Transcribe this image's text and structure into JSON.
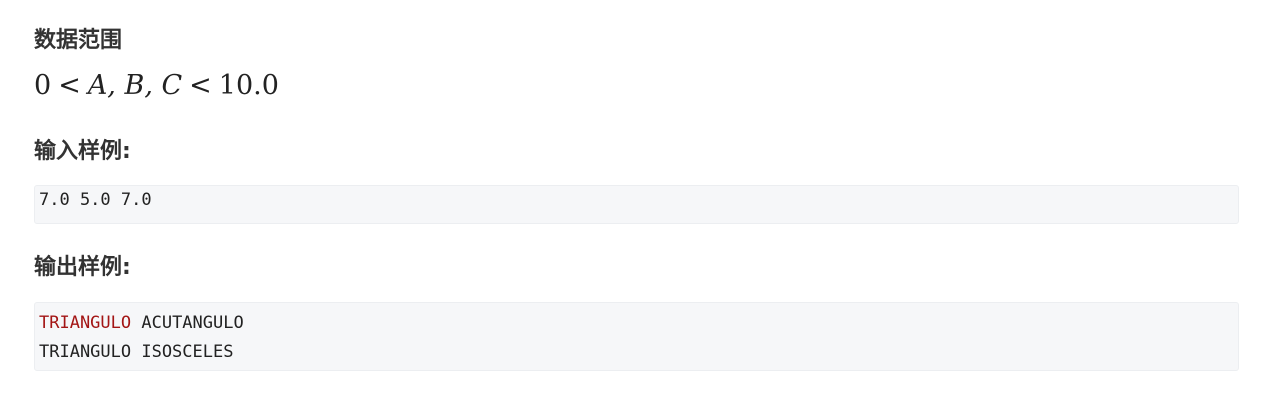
{
  "sections": {
    "range_heading": "数据范围",
    "input_heading": "输入样例:",
    "output_heading": "输出样例:"
  },
  "range": {
    "zero": "0",
    "lt": "<",
    "vars": "A, B, C",
    "lt2": "<",
    "max": "10.0"
  },
  "sample_input": {
    "line1": "7.0 5.0 7.0"
  },
  "sample_output": {
    "line1_keyword": "TRIANGULO",
    "line1_rest": " ACUTANGULO",
    "line2": "TRIANGULO ISOSCELES"
  }
}
